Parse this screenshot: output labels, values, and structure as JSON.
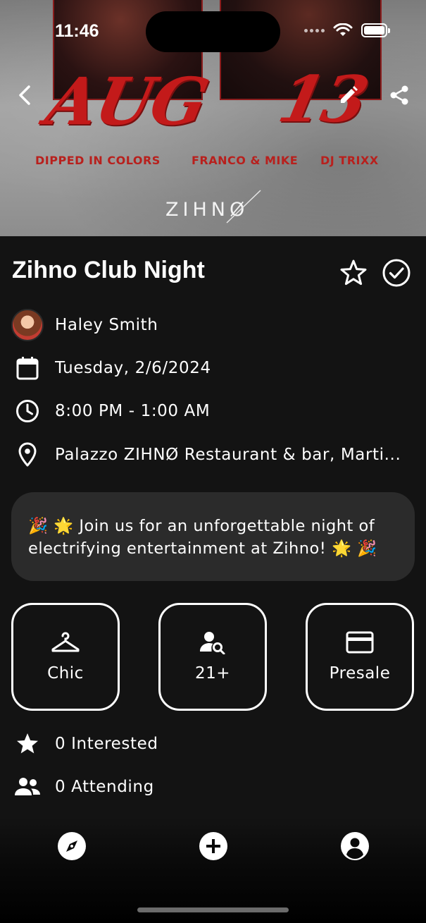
{
  "status_bar": {
    "time": "11:46"
  },
  "hero": {
    "headline_left": "AUG",
    "headline_right": "13",
    "lineup": [
      "DIPPED IN COLORS",
      "FRANCO & MIKE",
      "DJ TRIXX"
    ],
    "logo": "ZIHNØ"
  },
  "event": {
    "title": "Zihno Club Night",
    "host": "Haley Smith",
    "date": "Tuesday, 2/6/2024",
    "time": "8:00 PM - 1:00 AM",
    "location": "Palazzo ZIHNØ Restaurant & bar, Marti...",
    "description": "🎉 🌟  Join us for an unforgettable night of electrifying entertainment at Zihno! 🌟 🎉"
  },
  "tags": {
    "dress_code": "Chic",
    "age": "21+",
    "tickets": "Presale"
  },
  "stats": {
    "interested": "0 Interested",
    "attending": "0 Attending"
  },
  "icons": {
    "back": "chevron-left-icon",
    "edit": "pencil-icon",
    "share": "share-icon",
    "favorite": "star-outline-icon",
    "rsvp": "check-circle-icon",
    "calendar": "calendar-icon",
    "clock": "clock-icon",
    "location": "location-pin-icon",
    "dress": "hanger-icon",
    "age": "person-search-icon",
    "tickets": "credit-card-icon",
    "interested": "star-filled-icon",
    "attending": "people-icon",
    "nav": [
      "compass-icon",
      "plus-circle-icon",
      "account-circle-icon"
    ]
  },
  "colors": {
    "background": "#131313",
    "card": "#2b2b2b",
    "accent_red": "#c31a1a",
    "text": "#ffffff"
  }
}
